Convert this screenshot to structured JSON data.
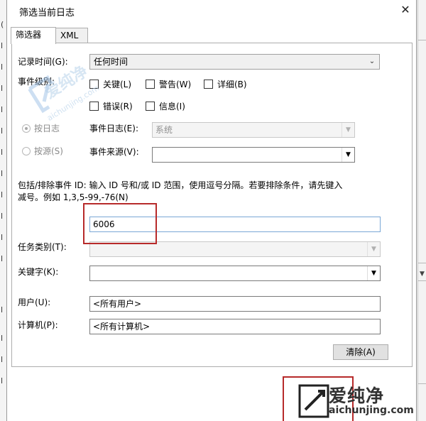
{
  "dialog": {
    "title": "筛选当前日志",
    "close_glyph": "✕"
  },
  "tabs": [
    {
      "label": "筛选器",
      "selected": true
    },
    {
      "label": "XML",
      "selected": false
    }
  ],
  "filter": {
    "logged_label": "记录时间(G):",
    "logged_value": "任何时间",
    "event_level_label": "事件级别:",
    "levels": [
      {
        "label": "关键(L)",
        "checked": false
      },
      {
        "label": "警告(W)",
        "checked": false
      },
      {
        "label": "详细(B)",
        "checked": false
      },
      {
        "label": "错误(R)",
        "checked": false
      },
      {
        "label": "信息(I)",
        "checked": false
      }
    ],
    "by_log_label": "按日志",
    "by_source_label": "按源(S)",
    "event_logs_label": "事件日志(E):",
    "event_logs_value": "系统",
    "event_sources_label": "事件来源(V):",
    "event_sources_value": "",
    "ids_description_line1": "包括/排除事件 ID: 输入 ID 号和/或 ID 范围，使用逗号分隔。若要排除条件，请先键入",
    "ids_description_line2": "减号。例如 1,3,5-99,-76(N)",
    "event_ids_value": "6006",
    "task_category_label": "任务类别(T):",
    "task_category_value": "",
    "keywords_label": "关键字(K):",
    "keywords_value": "",
    "user_label": "用户(U):",
    "user_value": "<所有用户>",
    "computer_label": "计算机(P):",
    "computer_value": "<所有计算机>",
    "clear_button": "清除(A)"
  },
  "watermark": {
    "text": "爱纯净",
    "url": "aichunjing.com"
  },
  "logo": {
    "text": "爱纯净",
    "url": "aichunjing.com"
  },
  "colors": {
    "highlight_red": "#b72a2a",
    "watermark_blue": "#b8d2ea"
  }
}
